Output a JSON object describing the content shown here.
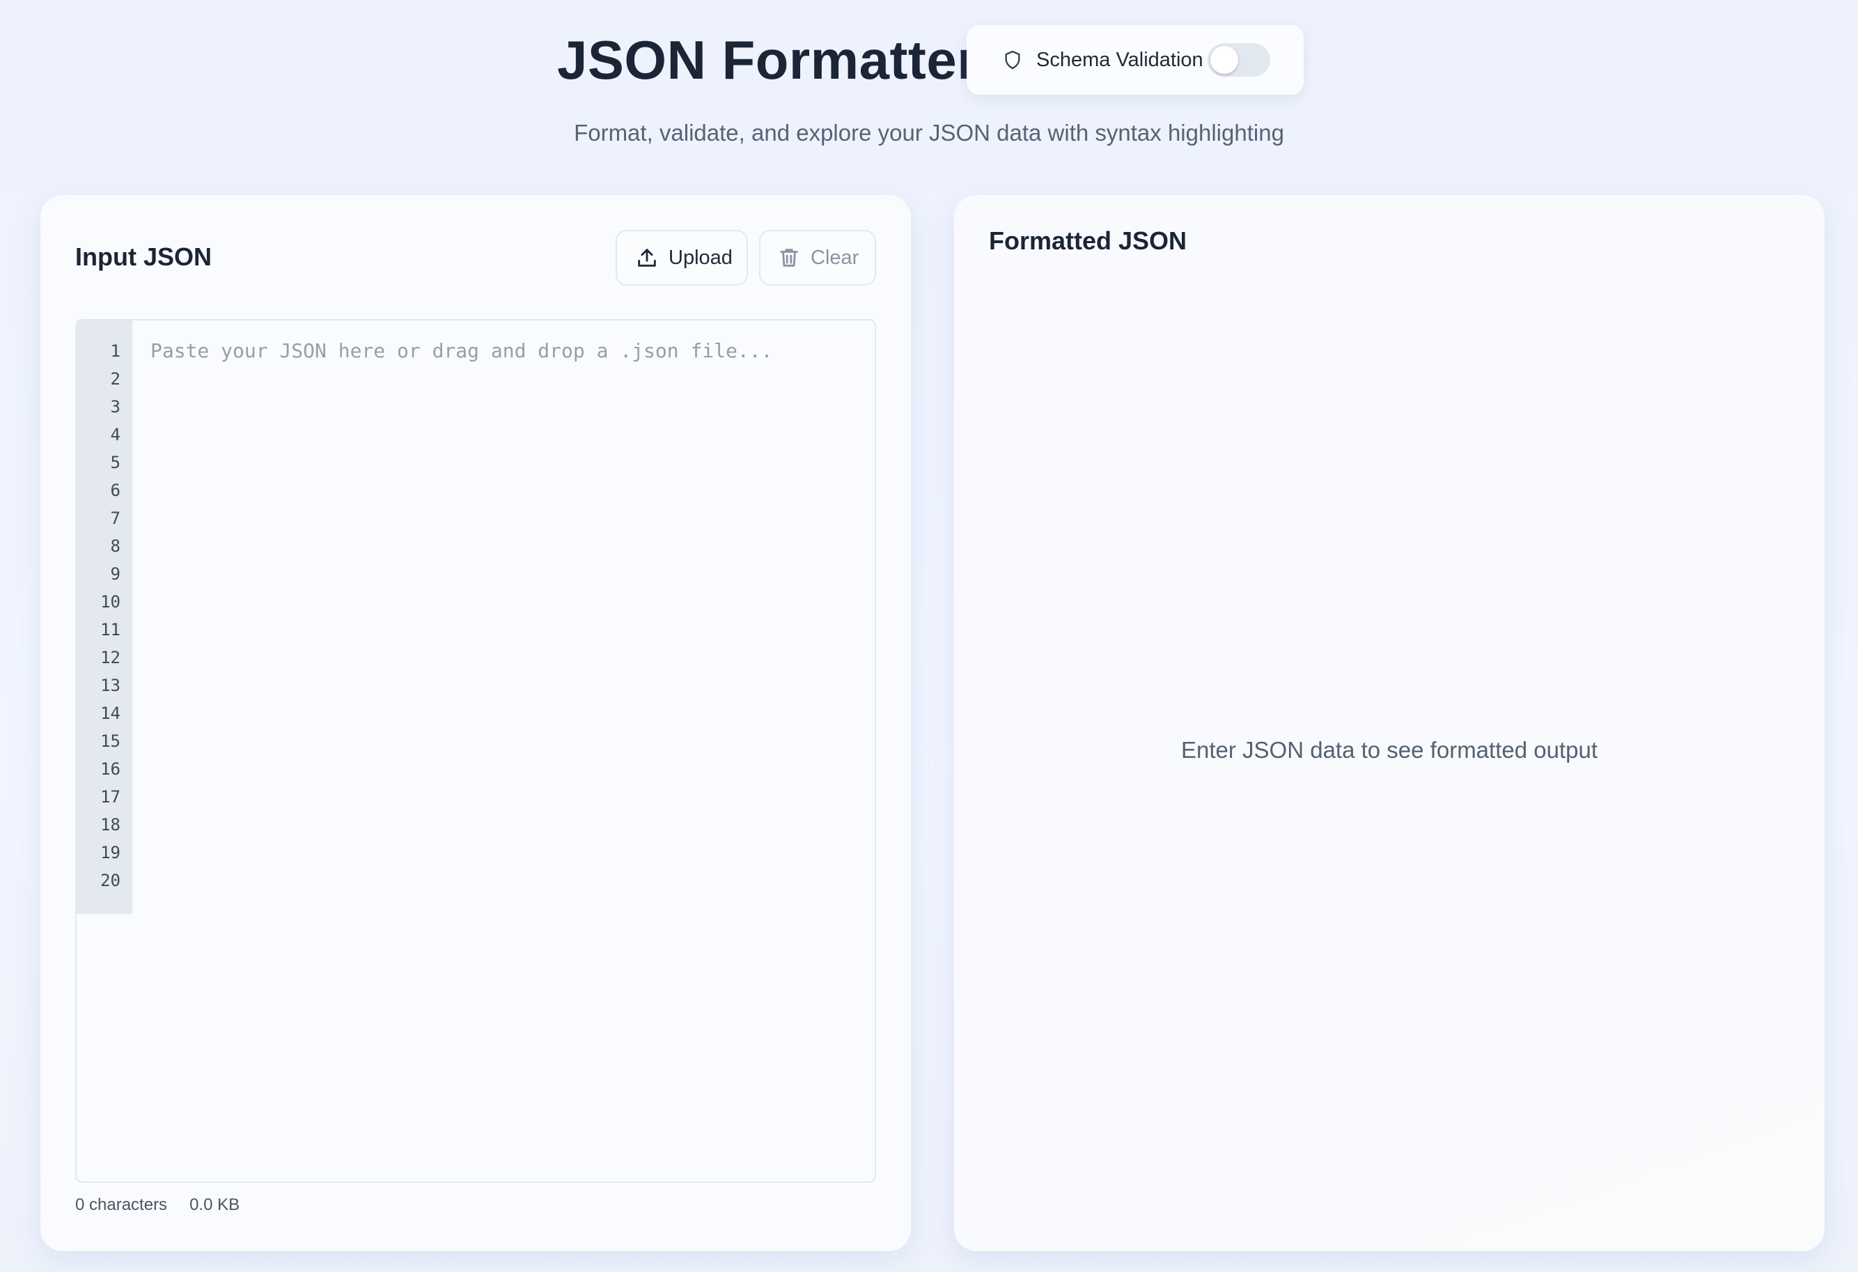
{
  "header": {
    "title": "JSON Formatter",
    "subtitle": "Format, validate, and explore your JSON data with syntax highlighting",
    "schema_validation": {
      "label": "Schema Validation",
      "enabled": false,
      "icon": "shield-icon"
    }
  },
  "input_panel": {
    "title": "Input JSON",
    "upload_label": "Upload",
    "upload_icon": "upload-icon",
    "clear_label": "Clear",
    "clear_icon": "trash-icon",
    "editor": {
      "placeholder": "Paste your JSON here or drag and drop a .json file...",
      "value": "",
      "line_numbers": [
        "1",
        "2",
        "3",
        "4",
        "5",
        "6",
        "7",
        "8",
        "9",
        "10",
        "11",
        "12",
        "13",
        "14",
        "15",
        "16",
        "17",
        "18",
        "19",
        "20"
      ]
    },
    "stats": {
      "characters": "0 characters",
      "size": "0.0 KB"
    }
  },
  "output_panel": {
    "title": "Formatted JSON",
    "empty_message": "Enter JSON data to see formatted output"
  },
  "colors": {
    "background": "#eef2fc",
    "panel": "#f9fbfe",
    "title_text": "#1b2536",
    "toggle_off": "#e2e8f0",
    "gutter": "#e4e9ef"
  }
}
